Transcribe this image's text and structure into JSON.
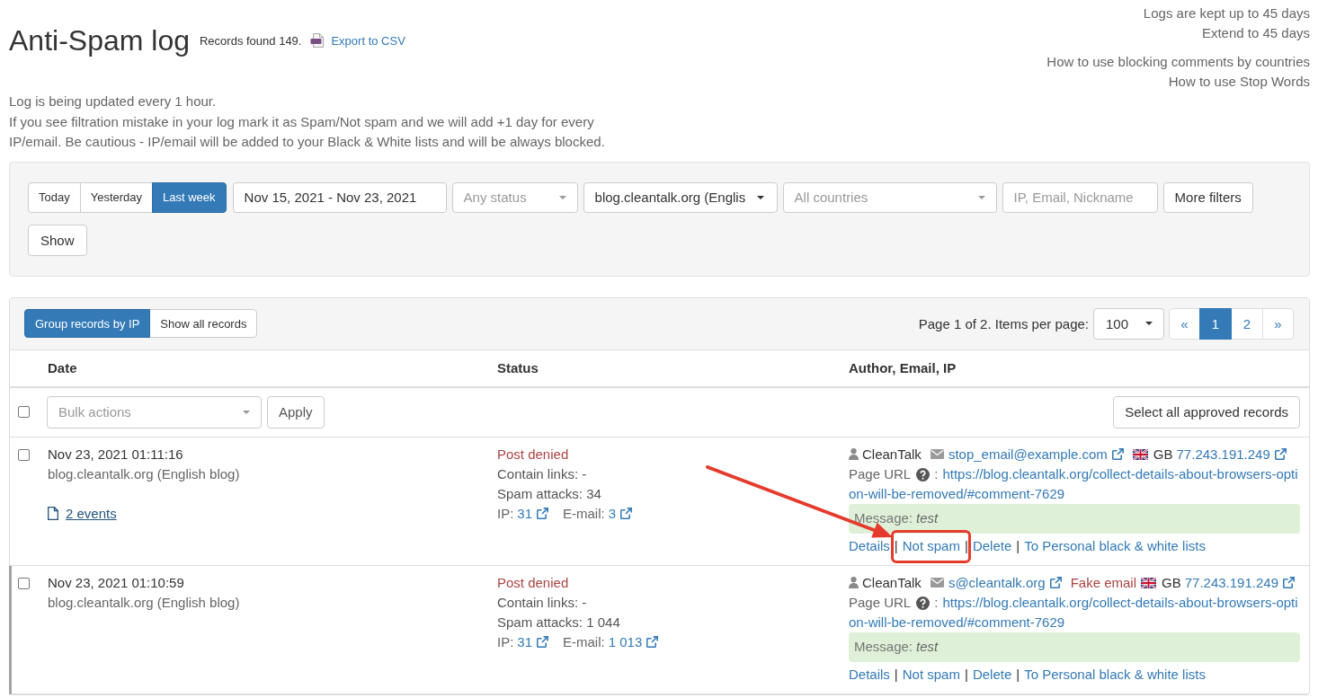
{
  "header": {
    "title": "Anti-Spam log",
    "records_found": "Records found 149.",
    "export_link": "Export to CSV"
  },
  "retention": {
    "note": "Logs are kept up to 45 days",
    "extend_link": "Extend to 45 days"
  },
  "help_links": [
    "How to use blocking comments by countries",
    "How to use Stop Words"
  ],
  "notice": [
    "Log is being updated every 1 hour.",
    "If you see filtration mistake in your log mark it as Spam/Not spam and we will add +1 day for every IP/email. Be cautious - IP/email will be added to your Black & White lists and will be always blocked."
  ],
  "filters": {
    "periods": [
      {
        "label": "Today",
        "selected": false
      },
      {
        "label": "Yesterday",
        "selected": false
      },
      {
        "label": "Last week",
        "selected": true
      }
    ],
    "date_range": {
      "value": "Nov 15, 2021 - Nov 23, 2021"
    },
    "status": {
      "placeholder": "Any status"
    },
    "site": {
      "value": "blog.cleantalk.org (Englis"
    },
    "country": {
      "placeholder": "All countries"
    },
    "search": {
      "placeholder": "IP, Email, Nickname"
    },
    "more_button": "More filters",
    "show_button": "Show"
  },
  "log": {
    "view_modes": [
      {
        "label": "Group records by IP",
        "selected": true
      },
      {
        "label": "Show all records",
        "selected": false
      }
    ],
    "pager_label": "Page 1 of 2. Items per page:",
    "per_page": {
      "value": "100"
    },
    "pages": [
      {
        "label": "«",
        "selected": false
      },
      {
        "label": "1",
        "selected": true
      },
      {
        "label": "2",
        "selected": false
      },
      {
        "label": "»",
        "selected": false
      }
    ],
    "columns": [
      "Date",
      "Status",
      "Author, Email, IP"
    ],
    "bulk": {
      "checked": false,
      "actions": {
        "placeholder": "Bulk actions"
      },
      "apply_button": "Apply",
      "select_all_button": "Select all approved records"
    },
    "action_separator": "|",
    "rows": [
      {
        "checked": false,
        "highlighted": false,
        "date": "Nov 23, 2021 01:11:16",
        "site": "blog.cleantalk.org (English blog)",
        "events_link": "2 events",
        "status": {
          "label": "Post denied",
          "kind": "denied"
        },
        "stats": [
          "Contain links: -",
          "Spam attacks: 34"
        ],
        "counts": [
          {
            "label": "IP:",
            "value": "31"
          },
          {
            "label": "E-mail:",
            "value": "3"
          }
        ],
        "author": "CleanTalk",
        "email": "stop_email@example.com",
        "country": "GB",
        "ip": "77.243.191.249",
        "page_url": {
          "label": "Page URL",
          "colon": ":",
          "link_lines": [
            "https://blog.cleantalk.org/collect-details-about-browsers-opti",
            "on-will-be-removed/#comment-7629"
          ]
        },
        "message": {
          "label": "Message:",
          "text": "test"
        },
        "actions": [
          {
            "label": "Details",
            "framed": false
          },
          {
            "label": "Not spam",
            "framed": true
          },
          {
            "label": "Delete",
            "framed": false
          },
          {
            "label": "To Personal black & white lists",
            "framed": false
          }
        ]
      },
      {
        "checked": false,
        "highlighted": true,
        "date": "Nov 23, 2021 01:10:59",
        "site": "blog.cleantalk.org (English blog)",
        "status": {
          "label": "Post denied",
          "kind": "denied"
        },
        "stats": [
          "Contain links: -",
          "Spam attacks: 1 044"
        ],
        "counts": [
          {
            "label": "IP:",
            "value": "31"
          },
          {
            "label": "E-mail:",
            "value": "1 013"
          }
        ],
        "author": "CleanTalk",
        "email": "s@cleantalk.org",
        "email_warning": "Fake email",
        "country": "GB",
        "ip": "77.243.191.249",
        "page_url": {
          "label": "Page URL",
          "colon": ":",
          "link_lines": [
            "https://blog.cleantalk.org/collect-details-about-browsers-opti",
            "on-will-be-removed/#comment-7629"
          ]
        },
        "message": {
          "label": "Message:",
          "text": "test"
        },
        "actions": [
          {
            "label": "Details",
            "framed": false
          },
          {
            "label": "Not spam",
            "framed": false
          },
          {
            "label": "Delete",
            "framed": false
          },
          {
            "label": "To Personal black & white lists",
            "framed": false
          }
        ]
      }
    ]
  }
}
